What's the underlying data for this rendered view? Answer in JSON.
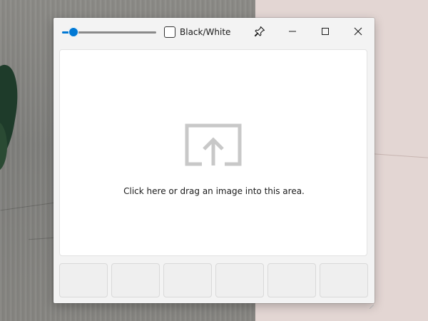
{
  "titlebar": {
    "slider_level": 0.12,
    "checkbox_label": "Black/White",
    "checkbox_checked": false,
    "pin_icon": "pin-icon",
    "minimize_icon": "minimize-icon",
    "maximize_icon": "maximize-icon",
    "close_icon": "close-icon"
  },
  "drop_area": {
    "icon": "upload-icon",
    "text": "Click here or drag an image into this area."
  },
  "thumbnails": [
    {
      "name": "thumbnail-slot-1"
    },
    {
      "name": "thumbnail-slot-2"
    },
    {
      "name": "thumbnail-slot-3"
    },
    {
      "name": "thumbnail-slot-4"
    },
    {
      "name": "thumbnail-slot-5"
    },
    {
      "name": "thumbnail-slot-6"
    }
  ],
  "colors": {
    "accent": "#0078d4",
    "window_bg": "#f3f3f3",
    "thumb_bg": "#efefef",
    "icon_gray": "#c8c8c8"
  }
}
